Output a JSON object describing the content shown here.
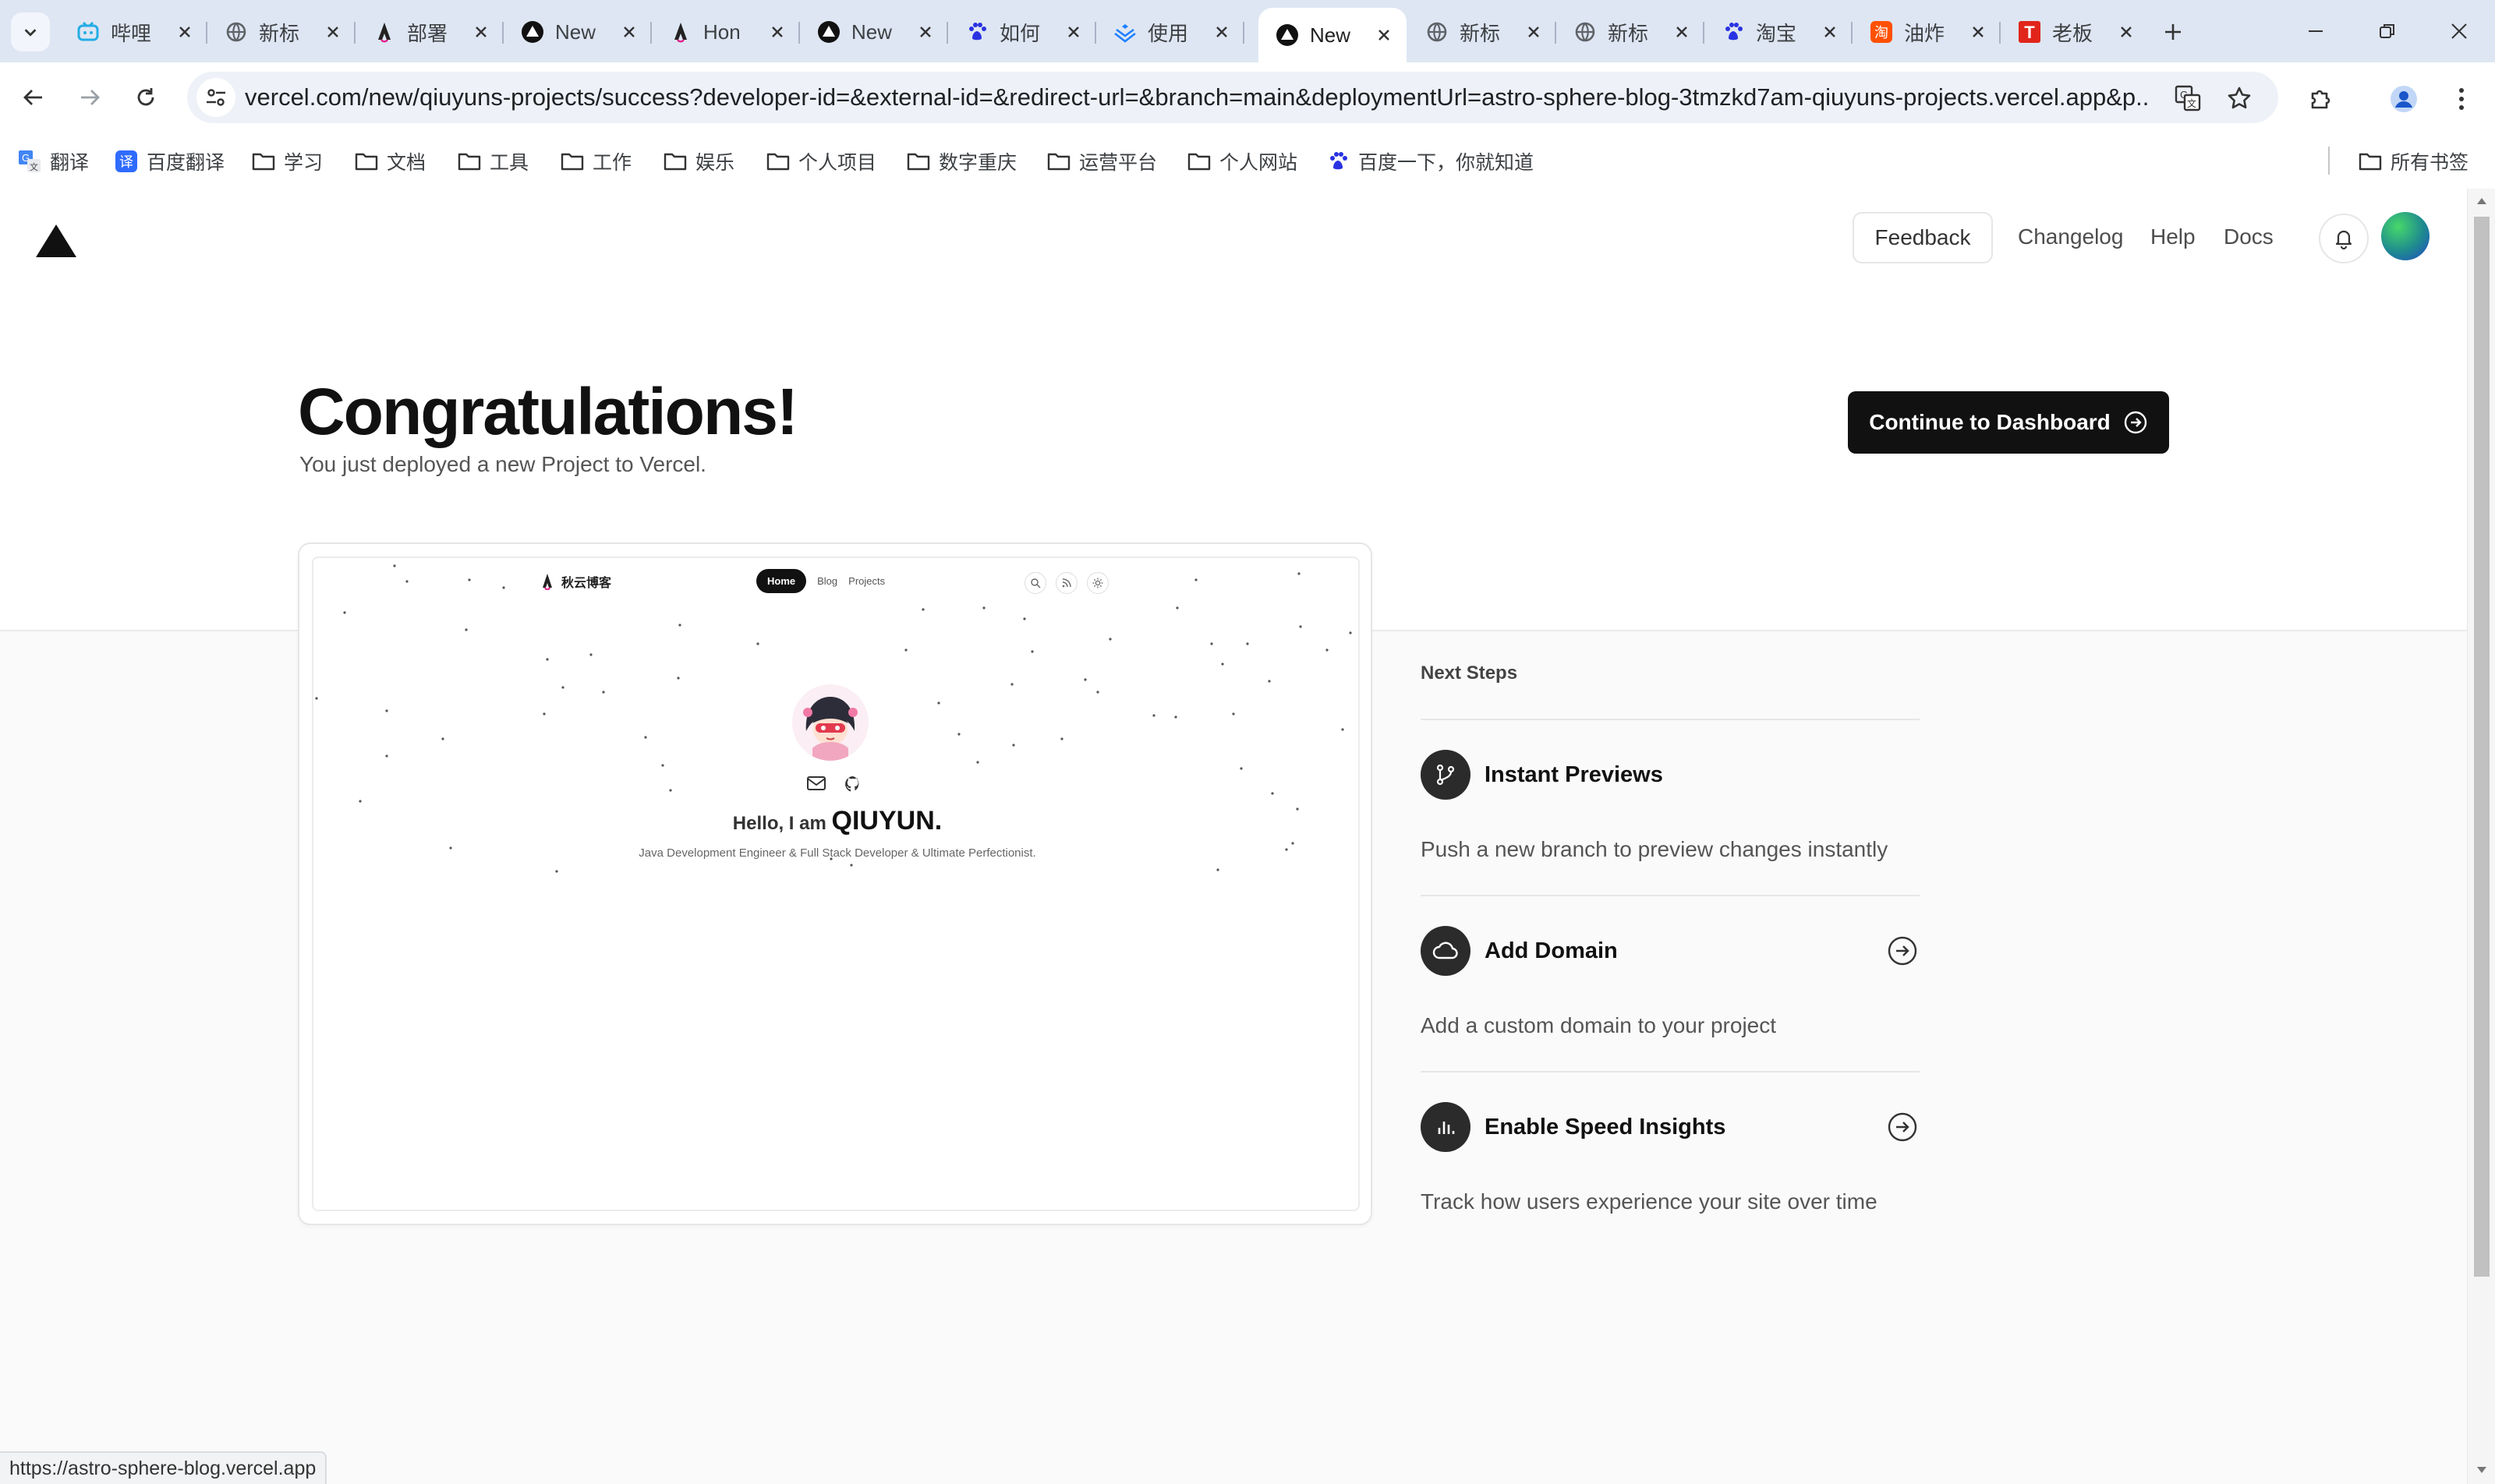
{
  "browser": {
    "tabs": [
      {
        "title": "哔哩",
        "icon": "bilibili-icon"
      },
      {
        "title": "新标",
        "icon": "globe-icon"
      },
      {
        "title": "部署",
        "icon": "astro-icon"
      },
      {
        "title": "New",
        "icon": "vercel-icon"
      },
      {
        "title": "Hon",
        "icon": "astro-icon"
      },
      {
        "title": "New",
        "icon": "vercel-icon"
      },
      {
        "title": "如何",
        "icon": "baidu-icon"
      },
      {
        "title": "使用",
        "icon": "juejin-icon"
      },
      {
        "title": "New",
        "icon": "vercel-icon",
        "active": true
      },
      {
        "title": "新标",
        "icon": "globe-icon"
      },
      {
        "title": "新标",
        "icon": "globe-icon"
      },
      {
        "title": "淘宝",
        "icon": "baidu-icon"
      },
      {
        "title": "油炸",
        "icon": "taobao-icon"
      },
      {
        "title": "老板",
        "icon": "t-icon"
      }
    ],
    "url": "vercel.com/new/qiuyuns-projects/success?developer-id=&external-id=&redirect-url=&branch=main&deploymentUrl=astro-sphere-blog-3tmzkd7am-qiuyuns-projects.vercel.app&p...",
    "bookmarks": [
      {
        "label": "翻译",
        "icon": "translate-icon"
      },
      {
        "label": "百度翻译",
        "icon": "baidu-translate-icon"
      },
      {
        "label": "学习",
        "icon": "folder-icon"
      },
      {
        "label": "文档",
        "icon": "folder-icon"
      },
      {
        "label": "工具",
        "icon": "folder-icon"
      },
      {
        "label": "工作",
        "icon": "folder-icon"
      },
      {
        "label": "娱乐",
        "icon": "folder-icon"
      },
      {
        "label": "个人项目",
        "icon": "folder-icon"
      },
      {
        "label": "数字重庆",
        "icon": "folder-icon"
      },
      {
        "label": "运营平台",
        "icon": "folder-icon"
      },
      {
        "label": "个人网站",
        "icon": "folder-icon"
      },
      {
        "label": "百度一下，你就知道",
        "icon": "baidu-icon"
      }
    ],
    "all_bookmarks": "所有书签",
    "status_url": "https://astro-sphere-blog.vercel.app"
  },
  "header": {
    "feedback": "Feedback",
    "changelog": "Changelog",
    "help": "Help",
    "docs": "Docs"
  },
  "hero": {
    "title": "Congratulations!",
    "subtitle": "You just deployed a new Project to Vercel.",
    "cta": "Continue to Dashboard"
  },
  "preview": {
    "site_name": "秋云博客",
    "nav": [
      "Home",
      "Blog",
      "Projects"
    ],
    "hello_prefix": "Hello, I am",
    "hello_name": "QIUYUN.",
    "description": "Java Development Engineer & Full Stack Developer & Ultimate Perfectionist."
  },
  "next_steps": {
    "title": "Next Steps",
    "items": [
      {
        "title": "Instant Previews",
        "description": "Push a new branch to preview changes instantly",
        "icon": "git-branch-icon"
      },
      {
        "title": "Add Domain",
        "description": "Add a custom domain to your project",
        "icon": "cloud-icon"
      },
      {
        "title": "Enable Speed Insights",
        "description": "Track how users experience your site over time",
        "icon": "bar-chart-icon"
      }
    ]
  }
}
